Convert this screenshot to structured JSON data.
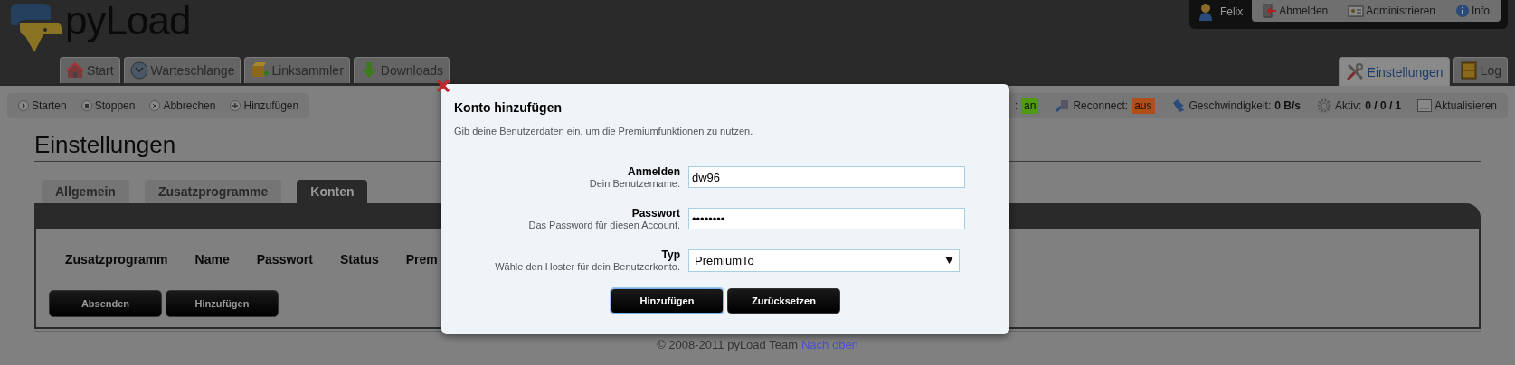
{
  "header": {
    "logo": "pyLoad",
    "user_name": "Felix",
    "user_links": [
      {
        "label": "Abmelden"
      },
      {
        "label": "Administrieren"
      },
      {
        "label": "Info"
      }
    ],
    "nav_tabs": [
      {
        "label": "Start",
        "selected": false
      },
      {
        "label": "Warteschlange",
        "selected": false
      },
      {
        "label": "Linksammler",
        "selected": false
      },
      {
        "label": "Downloads",
        "selected": false
      }
    ],
    "nav_tabs_right": [
      {
        "label": "Einstellungen",
        "selected": true
      },
      {
        "label": "Log",
        "selected": false
      }
    ]
  },
  "toolbar": {
    "actions": [
      "Starten",
      "Stoppen",
      "Abbrechen",
      "Hinzufügen"
    ],
    "switches": [
      {
        "label": ":",
        "value": "an",
        "on": true
      },
      {
        "label": "Reconnect:",
        "value": "aus",
        "on": false
      }
    ],
    "speed": {
      "label": "Geschwindigkeit:",
      "value": "0 B/s"
    },
    "active": {
      "label": "Aktiv:",
      "value": "0 / 0 / 1"
    },
    "refresh": "Aktualisieren"
  },
  "page_title": "Einstellungen",
  "tabs": [
    {
      "label": "Allgemein",
      "selected": false
    },
    {
      "label": "Zusatzprogramme",
      "selected": false
    },
    {
      "label": "Konten",
      "selected": true
    }
  ],
  "table": {
    "columns": [
      "Zusatzprogramm",
      "Name",
      "Passwort",
      "Status",
      "Prem"
    ]
  },
  "panel_buttons": [
    "Absenden",
    "Hinzufügen"
  ],
  "footer": {
    "text": "© 2008-2011 pyLoad Team",
    "link": "Nach oben"
  },
  "dialog": {
    "title": "Konto hinzufügen",
    "description": "Gib deine Benutzerdaten ein, um die Premiumfunktionen zu nutzen.",
    "fields": [
      {
        "kind": "text",
        "label": "Anmelden",
        "hint": "Dein Benutzername.",
        "value": "dw96"
      },
      {
        "kind": "text",
        "label": "Passwort",
        "hint": "Das Password für diesen Account.",
        "value": "••••••••"
      },
      {
        "kind": "select",
        "label": "Typ",
        "hint": "Wähle den Hoster für dein Benutzerkonto.",
        "value": "PremiumTo"
      }
    ],
    "buttons": [
      {
        "label": "Hinzufügen",
        "selected": true
      },
      {
        "label": "Zurücksetzen",
        "selected": false
      }
    ]
  }
}
